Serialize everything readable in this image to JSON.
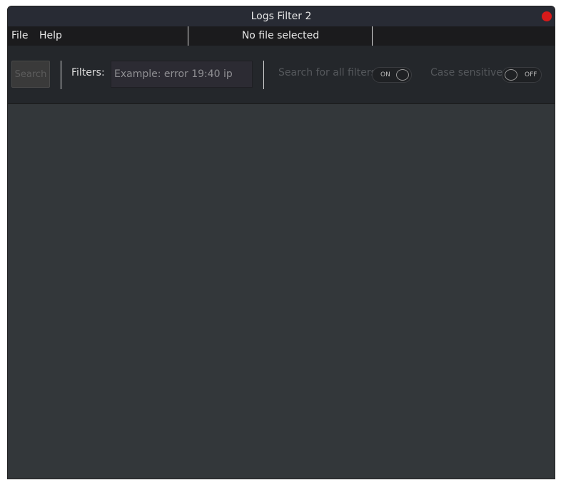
{
  "window": {
    "title": "Logs Filter 2"
  },
  "menubar": {
    "items": [
      {
        "label": "File"
      },
      {
        "label": "Help"
      }
    ],
    "status": "No file selected"
  },
  "toolbar": {
    "search_label": "Search",
    "filters_label": "Filters:",
    "filters_placeholder": "Example: error 19:40 ip",
    "all_filters_label": "Search for all filters",
    "all_filters_state": "ON",
    "case_label": "Case sensitive",
    "case_state": "OFF"
  }
}
